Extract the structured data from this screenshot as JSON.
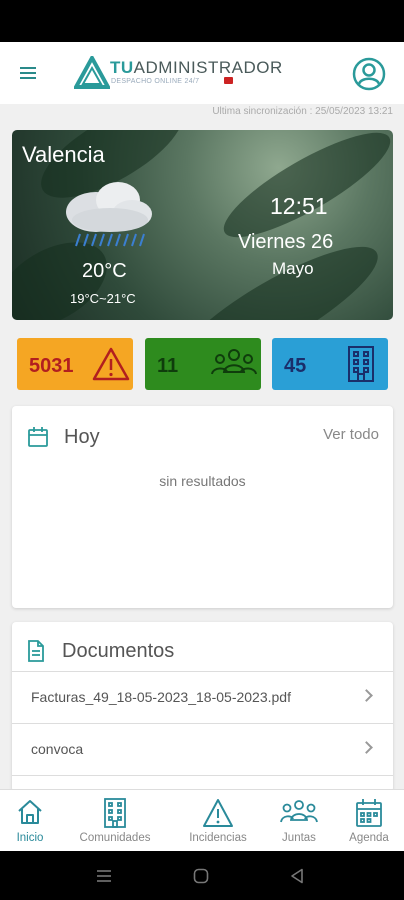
{
  "header": {
    "logo_brand": "TU",
    "logo_name": "ADMINISTRADOR",
    "logo_tagline": "DESPACHO ONLINE 24/7",
    "menu_icon": "hamburger-icon",
    "profile_icon": "user-circle-icon"
  },
  "sync": {
    "text": "Ultima sincronización : 25/05/2023 13:21"
  },
  "weather": {
    "city": "Valencia",
    "temperature": "20°C",
    "range": "19°C~21°C",
    "time": "12:51",
    "day": "Viernes 26",
    "month": "Mayo",
    "icon": "cloud-rain-icon"
  },
  "stats": [
    {
      "value": "5031",
      "icon": "warning-icon",
      "color": "#f5a623"
    },
    {
      "value": "11",
      "icon": "people-icon",
      "color": "#2e8b1e"
    },
    {
      "value": "45",
      "icon": "building-icon",
      "color": "#2a9fd6"
    }
  ],
  "today": {
    "title": "Hoy",
    "link": "Ver todo",
    "empty": "sin resultados",
    "icon": "calendar-icon"
  },
  "documents": {
    "title": "Documentos",
    "icon": "document-icon",
    "items": [
      {
        "label": "Facturas_49_18-05-2023_18-05-2023.pdf"
      },
      {
        "label": "convoca"
      }
    ]
  },
  "nav": {
    "items": [
      {
        "label": "Inicio",
        "icon": "home-icon",
        "active": true
      },
      {
        "label": "Comunidades",
        "icon": "building-icon"
      },
      {
        "label": "Incidencias",
        "icon": "warning-icon"
      },
      {
        "label": "Juntas",
        "icon": "people-icon"
      },
      {
        "label": "Agenda",
        "icon": "calendar-icon"
      }
    ]
  },
  "colors": {
    "accent": "#2a8a9a",
    "nav_active": "#2a8a9a"
  }
}
